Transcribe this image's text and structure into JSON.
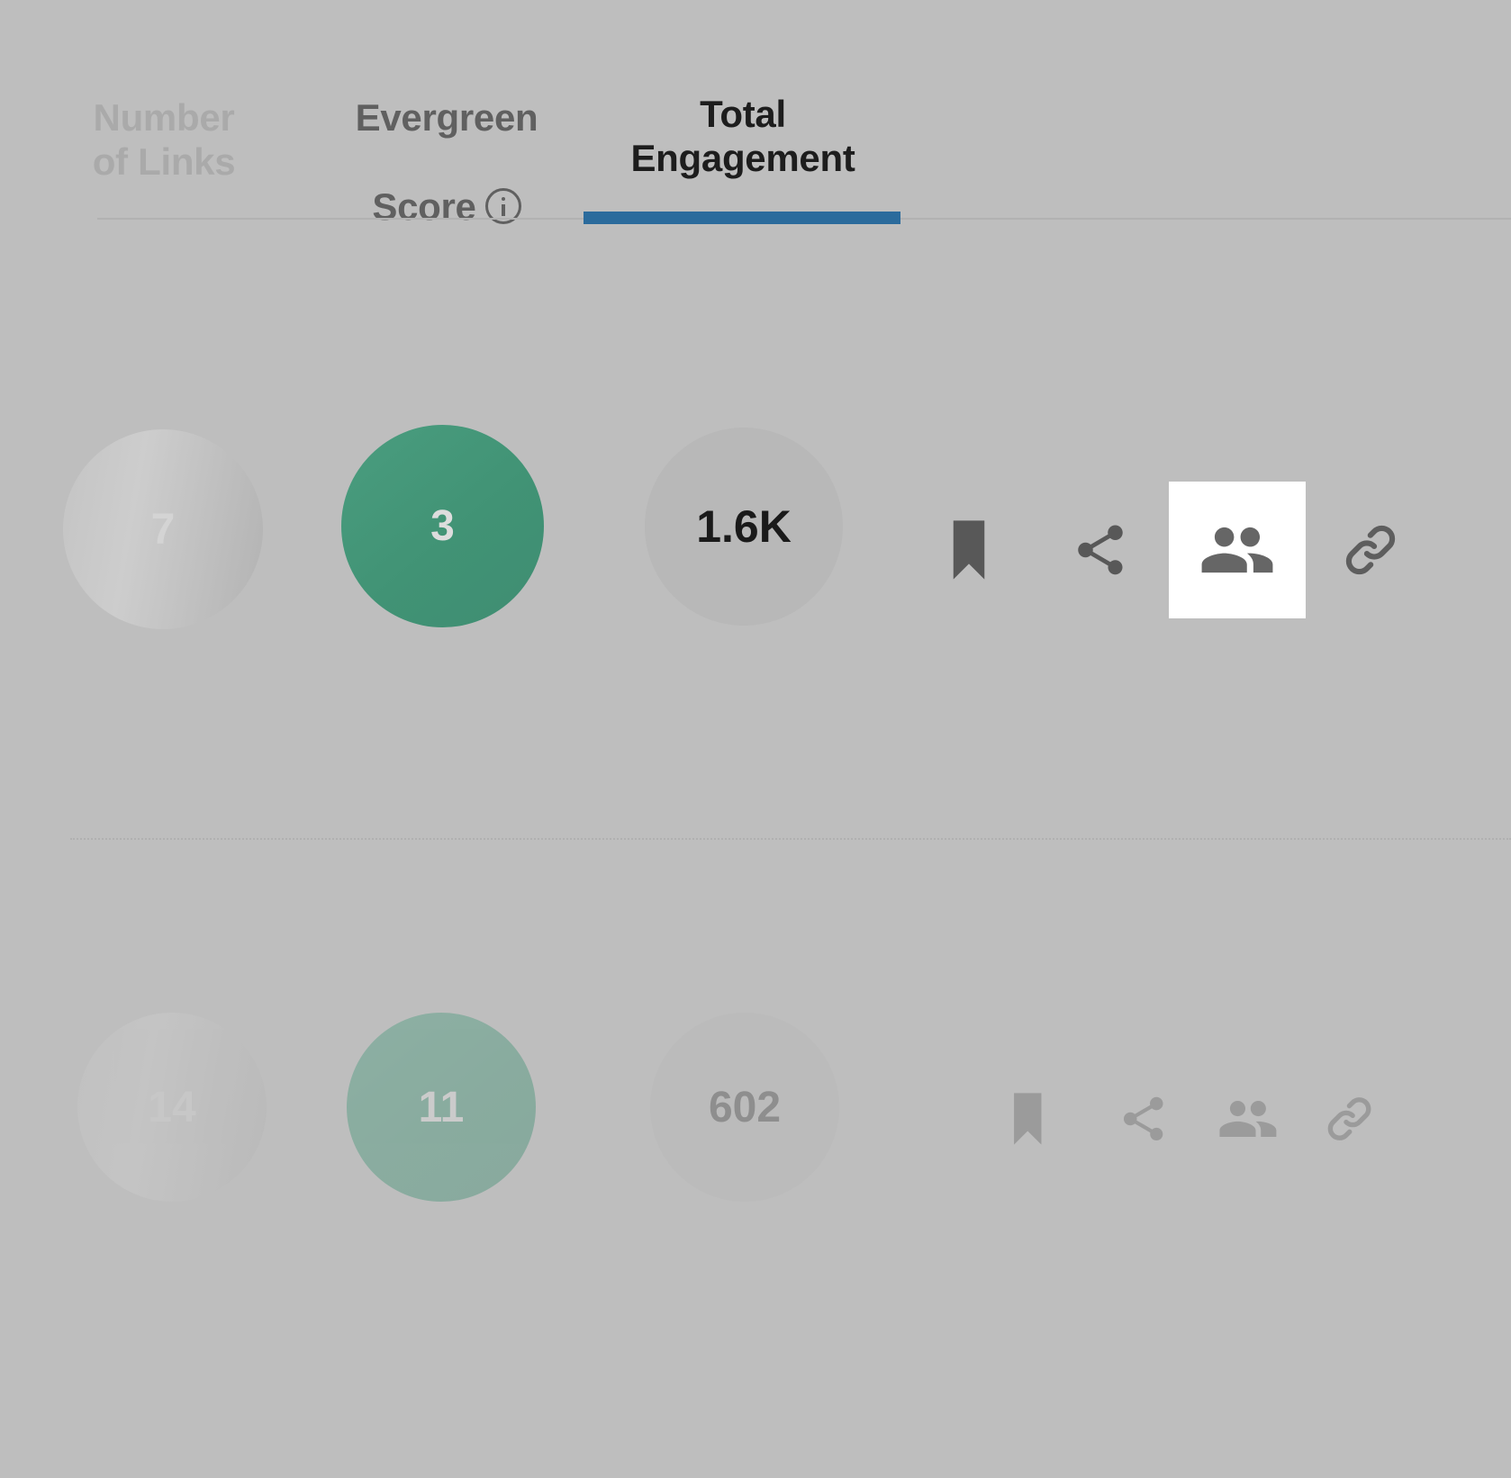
{
  "theme": {
    "background": "#bebebe",
    "accent_blue": "#2b6b9c",
    "green": "#459a7b",
    "neutral_bubble": "#b8b8b8",
    "active_icon_bg": "#ffffff",
    "icon_color": "#646464"
  },
  "tabs": [
    {
      "id": "number-of-links",
      "label": "Number\nof Links",
      "state": "inactive-dimmed",
      "has_info_icon": false
    },
    {
      "id": "evergreen-score",
      "label_line1": "Evergreen",
      "label_line2": "Score",
      "state": "inactive",
      "has_info_icon": true,
      "info_icon": "info-circle-icon"
    },
    {
      "id": "total-engagement",
      "label": "Total\nEngagement",
      "state": "active",
      "has_info_icon": false
    }
  ],
  "rows": [
    {
      "id": "row-1",
      "dimmed": false,
      "metrics": {
        "number_of_links": "7",
        "evergreen_score": "3",
        "total_engagement": "1.6K"
      },
      "actions": [
        {
          "id": "bookmark",
          "icon": "bookmark-icon",
          "active": false
        },
        {
          "id": "share",
          "icon": "share-icon",
          "active": false
        },
        {
          "id": "people",
          "icon": "people-icon",
          "active": true
        },
        {
          "id": "link",
          "icon": "link-chain-icon",
          "active": false
        }
      ]
    },
    {
      "id": "row-2",
      "dimmed": true,
      "metrics": {
        "number_of_links": "14",
        "evergreen_score": "11",
        "total_engagement": "602"
      },
      "actions": [
        {
          "id": "bookmark",
          "icon": "bookmark-icon",
          "active": false
        },
        {
          "id": "share",
          "icon": "share-icon",
          "active": false
        },
        {
          "id": "people",
          "icon": "people-icon",
          "active": false
        },
        {
          "id": "link",
          "icon": "link-chain-icon",
          "active": false
        }
      ]
    }
  ]
}
